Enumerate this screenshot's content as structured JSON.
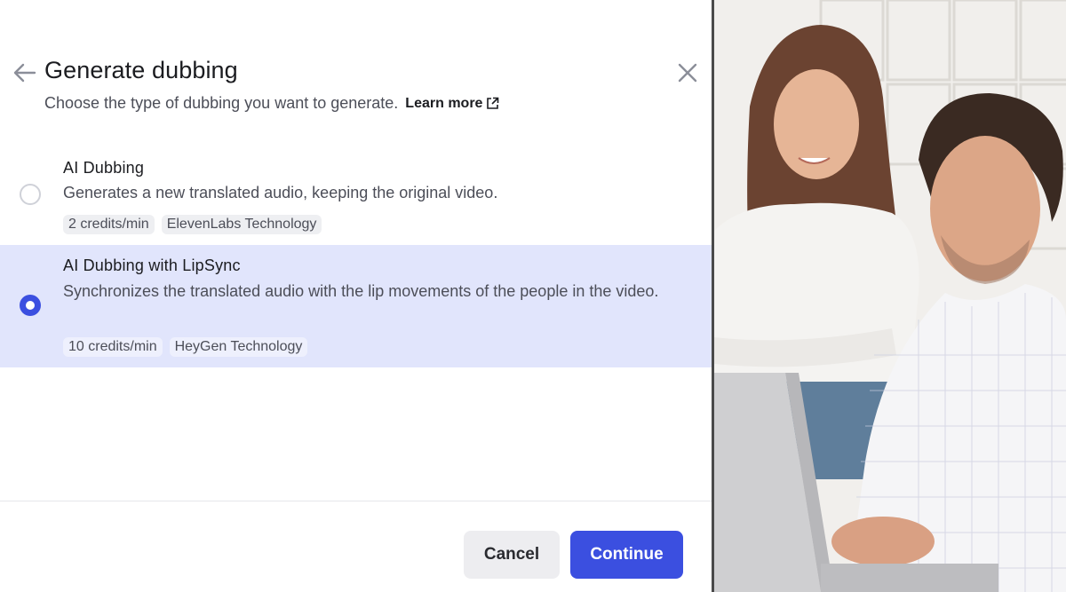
{
  "dialog": {
    "title": "Generate dubbing",
    "subtitle": "Choose the type of dubbing you want to generate.",
    "learn_more": "Learn more",
    "options": [
      {
        "title": "AI Dubbing",
        "description": "Generates a new translated audio, keeping the original video.",
        "tags": [
          "2 credits/min",
          "ElevenLabs Technology"
        ],
        "selected": false
      },
      {
        "title": "AI Dubbing with LipSync",
        "description": "Synchronizes the translated audio with the lip movements of the people in the video.",
        "tags": [
          "10 credits/min",
          "HeyGen Technology"
        ],
        "selected": true
      }
    ],
    "cancel_label": "Cancel",
    "continue_label": "Continue"
  },
  "icons": {
    "back": "arrow-left-icon",
    "close": "close-icon",
    "external": "external-link-icon"
  },
  "colors": {
    "accent": "#3b4fe0",
    "selected_bg": "#e1e5fc",
    "tag_bg": "#eeeff2"
  }
}
